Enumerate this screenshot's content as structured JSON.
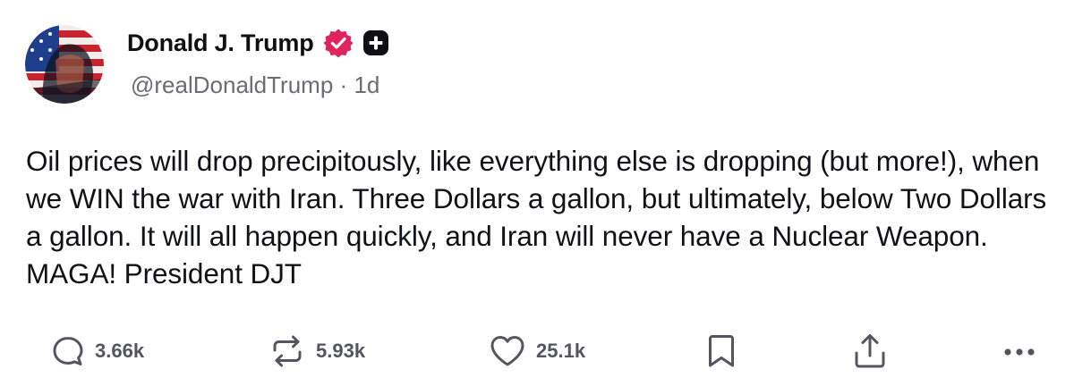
{
  "post": {
    "author": {
      "display_name": "Donald J. Trump",
      "handle": "@realDonaldTrump",
      "separator": "·",
      "time_ago": "1d",
      "verified_badge_color": "#e0245e",
      "avatar_icon": "avatar-portrait-flag"
    },
    "text": "Oil prices will drop precipitously, like everything else is dropping (but more!), when we WIN the war with Iran. Three Dollars a gallon, but ultimately, below Two Dollars a gallon. It will all happen quickly, and Iran will never have a Nuclear Weapon. MAGA! President DJT",
    "actions": {
      "replies": "3.66k",
      "reposts": "5.93k",
      "likes": "25.1k"
    },
    "colors": {
      "text": "#111118",
      "muted": "#6b6b76",
      "icon": "#55555f"
    }
  }
}
